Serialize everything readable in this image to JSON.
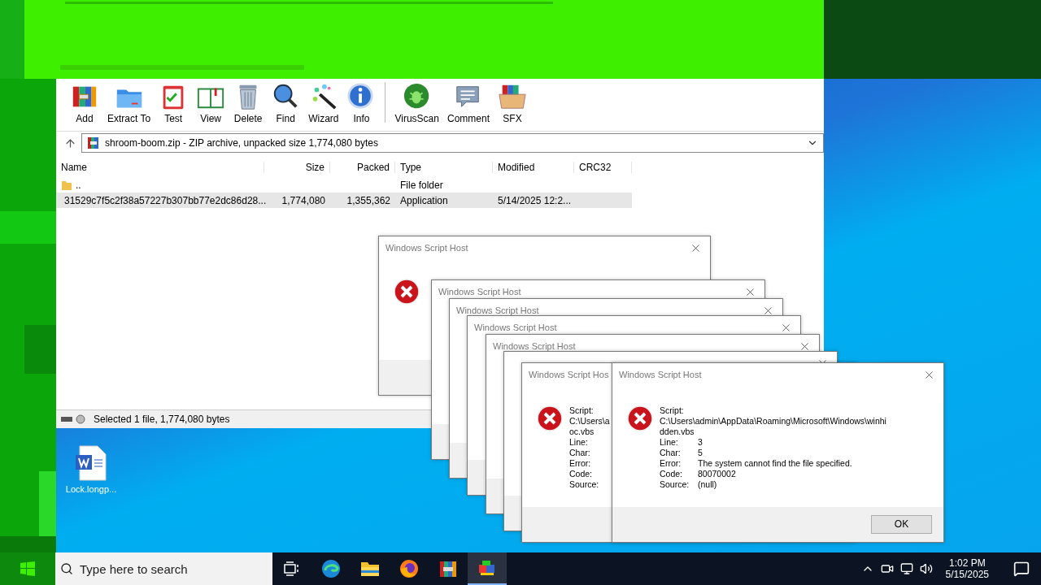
{
  "winrar": {
    "toolbar": [
      {
        "kind": "add",
        "label": "Add"
      },
      {
        "kind": "extract",
        "label": "Extract To"
      },
      {
        "kind": "test",
        "label": "Test"
      },
      {
        "kind": "view",
        "label": "View"
      },
      {
        "kind": "delete",
        "label": "Delete"
      },
      {
        "kind": "find",
        "label": "Find"
      },
      {
        "kind": "wizard",
        "label": "Wizard"
      },
      {
        "kind": "info",
        "label": "Info"
      },
      {
        "kind": "virusscan",
        "label": "VirusScan"
      },
      {
        "kind": "comment",
        "label": "Comment"
      },
      {
        "kind": "sfx",
        "label": "SFX"
      }
    ],
    "address": "shroom-boom.zip - ZIP archive, unpacked size 1,774,080 bytes",
    "columns": [
      "Name",
      "Size",
      "Packed",
      "Type",
      "Modified",
      "CRC32"
    ],
    "rows": [
      {
        "kind": "folder",
        "selected": false,
        "cells": [
          "..",
          "",
          "",
          "File folder",
          "",
          ""
        ]
      },
      {
        "kind": "app",
        "selected": true,
        "cells": [
          "31529c7f5c2f38a57227b307bb77e2dc86d28...",
          "1,774,080",
          "1,355,362",
          "Application",
          "5/14/2025 12:2...",
          ""
        ]
      }
    ],
    "status": "Selected 1 file, 1,774,080 bytes"
  },
  "desktop_icons": [
    {
      "label": "Lock.longp..."
    }
  ],
  "dialogs": [
    {
      "kind": "icon_only",
      "title": "Windows Script Host"
    },
    {
      "kind": "title_bar",
      "title": "Windows Script Host"
    },
    {
      "kind": "title_bar",
      "title": "Windows Script Host"
    },
    {
      "kind": "title_bar",
      "title": "Windows Script Host"
    },
    {
      "kind": "title_bar",
      "title": "Windows Script Host"
    },
    {
      "kind": "edge"
    },
    {
      "kind": "message_cut",
      "title": "Windows Script Hos",
      "script_label": "Script:",
      "path": [
        "C:\\Users\\a",
        "oc.vbs"
      ],
      "fields": [
        {
          "label": "Line:"
        },
        {
          "label": "Char:"
        },
        {
          "label": "Error:"
        },
        {
          "label": "Code:"
        },
        {
          "label": "Source:"
        }
      ]
    },
    {
      "kind": "message",
      "title": "Windows Script Host",
      "script_label": "Script:",
      "path": [
        "C:\\Users\\admin\\AppData\\Roaming\\Microsoft\\Windows\\winhi",
        "dden.vbs"
      ],
      "fields": [
        {
          "label": "Line:",
          "value": "3"
        },
        {
          "label": "Char:",
          "value": "5"
        },
        {
          "label": "Error:",
          "value": "The system cannot find the file specified."
        },
        {
          "label": "Code:",
          "value": "80070002"
        },
        {
          "label": "Source:",
          "value": "(null)"
        }
      ],
      "button": "OK"
    }
  ],
  "taskbar": {
    "search_placeholder": "Type here to search",
    "time": "1:02 PM",
    "date": "5/15/2025"
  }
}
